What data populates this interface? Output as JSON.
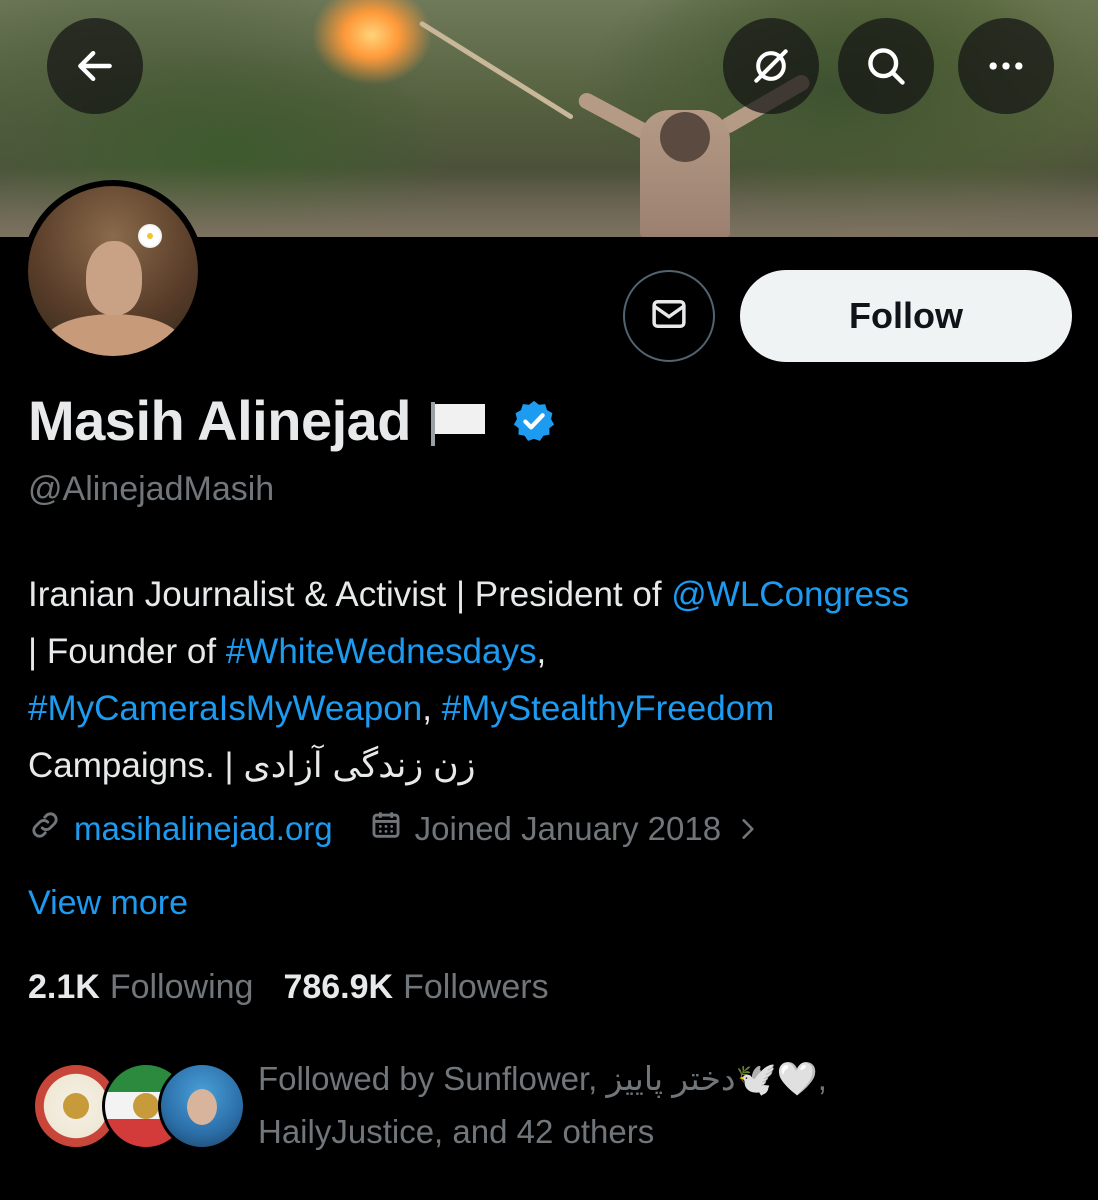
{
  "header": {
    "back_icon": "back-arrow-icon",
    "actions": [
      {
        "icon": "grok-icon"
      },
      {
        "icon": "search-icon"
      },
      {
        "icon": "more-icon"
      }
    ]
  },
  "profile": {
    "name": "Masih Alinejad",
    "name_emoji": "white-flag",
    "verified": true,
    "handle": "@AlinejadMasih",
    "bio": {
      "line1_text": "Iranian Journalist & Activist | President of ",
      "line1_link": "@WLCongress",
      "line2_text": "| Founder of ",
      "line2_link": "#WhiteWednesdays",
      "line2_suffix": ",",
      "line3_link1": "#MyCameraIsMyWeapon",
      "line3_sep": ", ",
      "line3_link2": "#MyStealthyFreedom",
      "line4_text": "Campaigns. | زن زندگی آزادی"
    },
    "website": "masihalinejad.org",
    "joined": "Joined January 2018",
    "view_more": "View more",
    "following_count": "2.1K",
    "following_label": "Following",
    "followers_count": "786.9K",
    "followers_label": "Followers",
    "followed_by": "Followed by Sunflower, دختر پاییز🕊️🤍,",
    "followed_by_line2": "HailyJustice, and 42 others"
  },
  "buttons": {
    "follow_label": "Follow",
    "message_icon": "mail-icon"
  },
  "colors": {
    "background": "#000000",
    "primary_text": "#e7e9ea",
    "secondary_text": "#71767b",
    "link": "#1d9bf0",
    "follow_button_bg": "#eff3f4"
  }
}
